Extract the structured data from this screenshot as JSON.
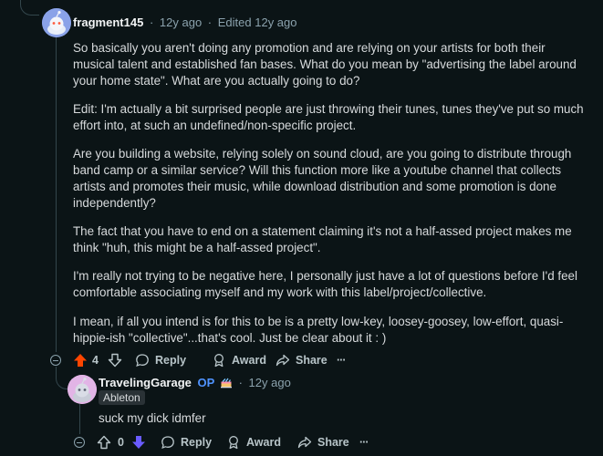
{
  "comment1": {
    "username": "fragment145",
    "separator": "·",
    "time": "12y ago",
    "edited": "Edited 12y ago",
    "paragraphs": [
      "So basically you aren't doing any promotion and are relying on your artists for both their musical talent and established fan bases. What do you mean by \"advertising the label around your home state\". What are you actually going to do?",
      "Edit: I'm actually a bit surprised people are just throwing their tunes, tunes they've put so much effort into, at such an undefined/non-specific project.",
      "Are you building a website, relying solely on sound cloud, are you going to distribute through band camp or a similar service? Will this function more like a youtube channel that collects artists and promotes their music, while download distribution and some promotion is done independently?",
      "The fact that you have to end on a statement claiming it's not a half-assed project makes me think \"huh, this might be a half-assed project\".",
      "I'm really not trying to be negative here, I personally just have a lot of questions before I'd feel comfortable associating myself and my work with this label/project/collective.",
      "I mean, if all you intend is for this to be is a pretty low-key, loosey-goosey, low-effort, quasi-hippie-ish \"collective\"...that's cool. Just be clear about it : )"
    ],
    "actions": {
      "score": "4",
      "reply": "Reply",
      "award": "Award",
      "share": "Share",
      "more": "···"
    },
    "colors": {
      "upvote_active": "#ff4500"
    }
  },
  "comment2": {
    "username": "TravelingGarage",
    "op_badge": "OP",
    "separator": "·",
    "time": "12y ago",
    "flair": "Ableton",
    "body": "suck my dick idmfer",
    "actions": {
      "score": "0",
      "reply": "Reply",
      "award": "Award",
      "share": "Share",
      "more": "···"
    },
    "colors": {
      "downvote_active": "#6a5cff"
    }
  }
}
